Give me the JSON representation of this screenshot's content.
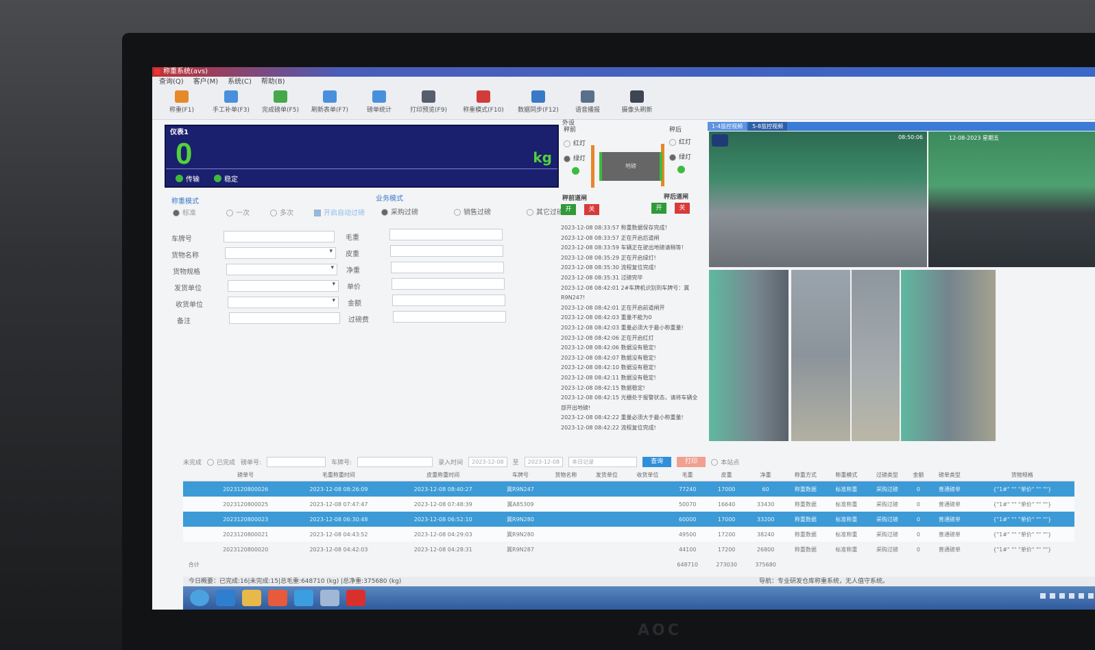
{
  "window": {
    "title": "称重系统(avs)"
  },
  "menu": [
    "查询(Q)",
    "客户(M)",
    "系统(C)",
    "帮助(B)"
  ],
  "toolbar": [
    {
      "label": "称重(F1)",
      "icon": "truck-icon",
      "color": "#e58a2a"
    },
    {
      "label": "手工补单(F3)",
      "icon": "edit-form-icon",
      "color": "#4a8fdc"
    },
    {
      "label": "完成磅单(F5)",
      "icon": "check-doc-icon",
      "color": "#46a84a"
    },
    {
      "label": "刷新表单(F7)",
      "icon": "refresh-doc-icon",
      "color": "#4a8fdc"
    },
    {
      "label": "磅单统计",
      "icon": "stats-doc-icon",
      "color": "#4a8fdc"
    },
    {
      "label": "打印预览(F9)",
      "icon": "printer-icon",
      "color": "#555e6a"
    },
    {
      "label": "称重模式(F10)",
      "icon": "scale-icon",
      "color": "#d33b3b"
    },
    {
      "label": "数据同步(F12)",
      "icon": "upload-icon",
      "color": "#3a78c8"
    },
    {
      "label": "语音播报",
      "icon": "speaker-icon",
      "color": "#5a6f8a"
    },
    {
      "label": "摄像头刷新",
      "icon": "camera-icon",
      "color": "#3e4652"
    }
  ],
  "meter": {
    "title": "仪表1",
    "value": "0",
    "unit": "kg",
    "status1": "传输",
    "status2": "稳定",
    "color_digits": "#52d13c"
  },
  "weigh_mode": {
    "title": "称重模式",
    "options": [
      "标准",
      "一次",
      "多次"
    ],
    "checkbox": "开启自动过磅"
  },
  "business_mode": {
    "title": "业务模式",
    "options": [
      "采购过磅",
      "销售过磅",
      "其它过磅"
    ]
  },
  "form": {
    "left_labels": [
      "车牌号",
      "货物名称",
      "货物规格",
      "发货单位",
      "收货单位",
      "备注"
    ],
    "right_labels": [
      "毛重",
      "皮重",
      "净重",
      "单价",
      "金额",
      "过磅费"
    ]
  },
  "barrier": {
    "title": "外设",
    "front": "秤前",
    "back": "秤后",
    "red": "红灯",
    "green": "绿灯",
    "platform": "地磅",
    "front_gate": "秤前道闸",
    "back_gate": "秤后道闸",
    "open": "开",
    "close": "关"
  },
  "log": [
    "2023-12-08 08:33:57 称重数据保存完成！",
    "2023-12-08 08:33:57 正在开启后道闸",
    "2023-12-08 08:33:59 车辆正在驶出地磅请稍等！",
    "2023-12-08 08:35:29 正在开启绿灯!",
    "2023-12-08 08:35:30 流程复位完成!",
    "2023-12-08 08:35:31 过磅完毕",
    "2023-12-08 08:42:01 2#车牌机识别到车牌号：冀",
    "R9N247!",
    "2023-12-08 08:42:01 正在开启前道闸开",
    "2023-12-08 08:42:03 重量不能为0",
    "2023-12-08 08:42:03 重量必须大于最小称重量!",
    "2023-12-08 08:42:06 正在开启红灯",
    "2023-12-08 08:42:06 数据没有稳定!",
    "2023-12-08 08:42:07 数据没有稳定!",
    "2023-12-08 08:42:10 数据没有稳定!",
    "2023-12-08 08:42:11 数据没有稳定!",
    "2023-12-08 08:42:15 数据稳定!",
    "2023-12-08 08:42:15 光栅处于报警状态，请将车辆全",
    "部开出地磅!",
    "2023-12-08 08:42:22 重量必须大于最小称重量!",
    "2023-12-08 08:42:22 流程复位完成!"
  ],
  "cameras": {
    "tabs": [
      "1-4监控视频",
      "5-8监控视频"
    ],
    "cam1_time": "08:50:06",
    "cam2_time": "12-08-2023 星期五"
  },
  "filter": {
    "unfinished": "未完成",
    "finished": "已完成",
    "bill_no": "磅单号:",
    "plate": "车牌号:",
    "date_label": "录入时间",
    "date_from": "2023-12-08",
    "to": "至",
    "date_to": "2023-12-08",
    "range": "本日记录",
    "query": "查询",
    "print": "打印",
    "local": "本站点"
  },
  "table": {
    "headers": [
      "磅单号",
      "毛重称重时间",
      "皮重称重时间",
      "车牌号",
      "货物名称",
      "发货单位",
      "收货单位",
      "毛重",
      "皮重",
      "净重",
      "称重方式",
      "称重模式",
      "过磅类型",
      "金额",
      "磅单类型",
      "货物规格"
    ],
    "rows": [
      {
        "sel": true,
        "cells": [
          "2023120800026",
          "2023-12-08 08:26:09",
          "2023-12-08 08:40:27",
          "冀R9N247",
          "",
          "",
          "",
          "77240",
          "17000",
          "60",
          "称重数据",
          "标准称重",
          "采购过磅",
          "0",
          "普通磅单",
          "{\"1#\"  \"\"  \"单价\"  \"\"  \"\"}"
        ]
      },
      {
        "sel": false,
        "cells": [
          "2023120800025",
          "2023-12-08 07:47:47",
          "2023-12-08 07:48:39",
          "冀A85309",
          "",
          "",
          "",
          "50070",
          "16640",
          "33430",
          "称重数据",
          "标准称重",
          "采购过磅",
          "0",
          "普通磅单",
          "{\"1#\"  \"\"  \"单价\"  \"\"  \"\"}"
        ]
      },
      {
        "sel": true,
        "cells": [
          "2023120800023",
          "2023-12-08 06:30:48",
          "2023-12-08 06:52:10",
          "冀R9N280",
          "",
          "",
          "",
          "60000",
          "17000",
          "33200",
          "称重数据",
          "标准称重",
          "采购过磅",
          "0",
          "普通磅单",
          "{\"1#\"  \"\"  \"单价\"  \"\"  \"\"}"
        ]
      },
      {
        "sel": false,
        "cells": [
          "2023120800021",
          "2023-12-08 04:43:52",
          "2023-12-08 04:29:03",
          "冀R9N280",
          "",
          "",
          "",
          "49500",
          "17200",
          "38240",
          "称重数据",
          "标准称重",
          "采购过磅",
          "0",
          "普通磅单",
          "{\"1#\"  \"\"  \"单价\"  \"\"  \"\"}"
        ]
      },
      {
        "sel": false,
        "cells": [
          "2023120800020",
          "2023-12-08 04:42:03",
          "2023-12-08 04:28:31",
          "冀R9N287",
          "",
          "",
          "",
          "44100",
          "17200",
          "26800",
          "称重数据",
          "标准称重",
          "采购过磅",
          "0",
          "普通磅单",
          "{\"1#\"  \"\"  \"单价\"  \"\"  \"\"}"
        ]
      }
    ],
    "total_label": "合计",
    "totals": [
      "648710",
      "273030",
      "375680"
    ]
  },
  "status": {
    "summary": "今日概要：已完成:16|未完成:15|总毛重:648710 (kg) |总净重:375680 (kg)",
    "right": "导航：专业研发仓库称重系统，无人值守系统。"
  },
  "taskbar": {
    "colors": [
      "#4aa3e0",
      "#2f7fd1",
      "#e7b84a",
      "#e85a3c",
      "#3a9ee0",
      "#a0b8d6",
      "#d9302d"
    ]
  }
}
